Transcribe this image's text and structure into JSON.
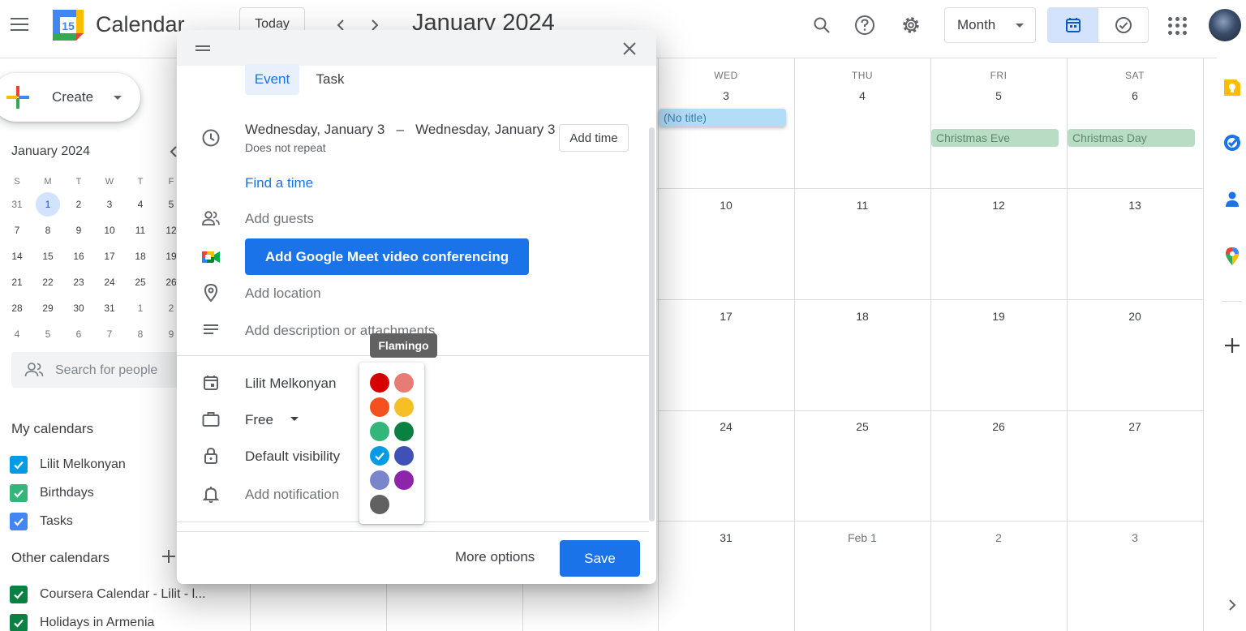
{
  "topbar": {
    "app_name": "Calendar",
    "logo_day": "15",
    "today_label": "Today",
    "month_title": "January 2024",
    "view_select": "Month"
  },
  "sidebar": {
    "create_label": "Create",
    "mini_calendar": {
      "title": "January 2024",
      "weekday_heads": [
        "S",
        "M",
        "T",
        "W",
        "T",
        "F"
      ],
      "rows": [
        [
          "31",
          "1",
          "2",
          "3",
          "4",
          "5"
        ],
        [
          "7",
          "8",
          "9",
          "10",
          "11",
          "12"
        ],
        [
          "14",
          "15",
          "16",
          "17",
          "18",
          "19"
        ],
        [
          "21",
          "22",
          "23",
          "24",
          "25",
          "26"
        ],
        [
          "28",
          "29",
          "30",
          "31",
          "1",
          "2"
        ],
        [
          "4",
          "5",
          "6",
          "7",
          "8",
          "9"
        ]
      ]
    },
    "people_search_placeholder": "Search for people",
    "my_calendars_title": "My calendars",
    "my_calendars": [
      {
        "label": "Lilit Melkonyan",
        "color": "#039be5"
      },
      {
        "label": "Birthdays",
        "color": "#33b679"
      },
      {
        "label": "Tasks",
        "color": "#4285f4"
      }
    ],
    "other_calendars_title": "Other calendars",
    "other_calendars": [
      {
        "label": "Coursera Calendar - Lilit - l...",
        "color": "#0b8043"
      },
      {
        "label": "Holidays in Armenia",
        "color": "#0b8043"
      }
    ]
  },
  "calendar_grid": {
    "columns": [
      {
        "day_name": "WED",
        "date": "3"
      },
      {
        "day_name": "THU",
        "date": "4"
      },
      {
        "day_name": "FRI",
        "date": "5"
      },
      {
        "day_name": "SAT",
        "date": "6"
      }
    ],
    "weeks": [
      [
        "10",
        "11",
        "12",
        "13"
      ],
      [
        "17",
        "18",
        "19",
        "20"
      ],
      [
        "24",
        "25",
        "26",
        "27"
      ],
      [
        "31",
        "Feb 1",
        "2",
        "3"
      ]
    ],
    "events": [
      {
        "label": "(No title)",
        "color": "#b3dcf7",
        "text_color": "#3c7fb0"
      },
      {
        "label": "Christmas Eve",
        "color": "#b8dcc4",
        "text_color": "#5b8a6b"
      },
      {
        "label": "Christmas Day",
        "color": "#b8dcc4",
        "text_color": "#5b8a6b"
      }
    ]
  },
  "dialog": {
    "tabs": {
      "event": "Event",
      "task": "Task"
    },
    "date_range": "Wednesday, January 3   –   Wednesday, January 3",
    "repeat": "Does not repeat",
    "add_time": "Add time",
    "find_time": "Find a time",
    "add_guests": "Add guests",
    "meet_button": "Add Google Meet video conferencing",
    "add_location": "Add location",
    "add_description": "Add description or attachments",
    "calendar_owner": "Lilit Melkonyan",
    "availability": "Free",
    "visibility": "Default visibility",
    "notification": "Add notification",
    "more_options": "More options",
    "save": "Save"
  },
  "color_picker": {
    "tooltip": "Flamingo",
    "swatches": [
      {
        "name": "Tomato",
        "color": "#d50000"
      },
      {
        "name": "Flamingo",
        "color": "#e67c73"
      },
      {
        "name": "Tangerine",
        "color": "#f4511e"
      },
      {
        "name": "Banana",
        "color": "#f6bf26"
      },
      {
        "name": "Sage",
        "color": "#33b679"
      },
      {
        "name": "Basil",
        "color": "#0b8043"
      },
      {
        "name": "Peacock",
        "color": "#039be5"
      },
      {
        "name": "Blueberry",
        "color": "#3f51b5"
      },
      {
        "name": "Lavender",
        "color": "#7986cb"
      },
      {
        "name": "Grape",
        "color": "#8e24aa"
      },
      {
        "name": "Graphite",
        "color": "#616161"
      }
    ],
    "selected": "Peacock",
    "hovered": "Flamingo"
  }
}
